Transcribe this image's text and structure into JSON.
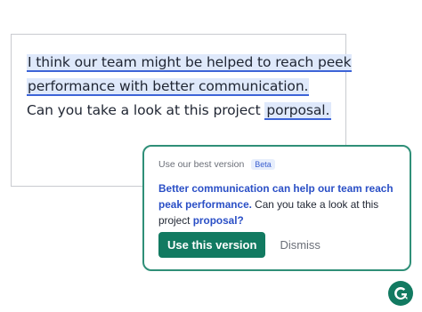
{
  "editor": {
    "line1": "I think our team might be helped to reach peek",
    "line2": "performance with better communication.",
    "line3_prefix": "Can you take a look at this project ",
    "line3_flagged": "porposal."
  },
  "suggestion": {
    "caption": "Use our best version",
    "badge": "Beta",
    "rewrite_strong": "Better communication can help our team reach peak performance.",
    "rewrite_plain": " Can you take a look at this project ",
    "rewrite_fix": "proposal?",
    "primary_button": "Use this version",
    "dismiss_button": "Dismiss"
  },
  "colors": {
    "accent_green": "#127a61",
    "highlight_blue": "#3d64d7",
    "highlight_fill": "#dfe9fb"
  },
  "icons": {
    "logo": "grammarly-logo-icon"
  }
}
